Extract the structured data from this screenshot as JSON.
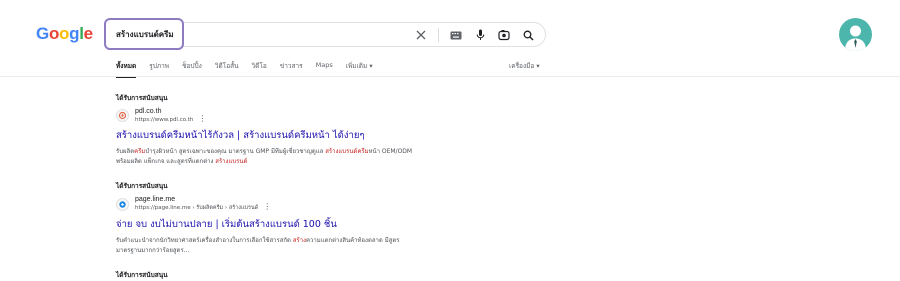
{
  "logo": {
    "letters": [
      "G",
      "o",
      "o",
      "g",
      "l",
      "e"
    ],
    "colors": [
      "#4285f4",
      "#ea4335",
      "#fbbc05",
      "#4285f4",
      "#34a853",
      "#ea4335"
    ]
  },
  "search": {
    "query": "สร้างแบรนด์ครีม"
  },
  "icons": {
    "clear": "close-icon",
    "keyboard": "keyboard-icon",
    "voice": "microphone-icon",
    "lens": "lens-icon",
    "search": "search-icon"
  },
  "tabs": {
    "items": [
      {
        "label": "ทั้งหมด",
        "active": true
      },
      {
        "label": "รูปภาพ",
        "active": false
      },
      {
        "label": "ช็อปปิ้ง",
        "active": false
      },
      {
        "label": "วิดีโอสั้น",
        "active": false
      },
      {
        "label": "วิดีโอ",
        "active": false
      },
      {
        "label": "ข่าวสาร",
        "active": false
      },
      {
        "label": "Maps",
        "active": false
      },
      {
        "label": "เพิ่มเติม",
        "active": false
      }
    ],
    "tools": "เครื่องมือ"
  },
  "results": [
    {
      "sponsored": "ได้รับการสนับสนุน",
      "site": "pdl.co.th",
      "url": "https://www.pdl.co.th",
      "title": "สร้างแบรนด์ครีมหน้าไร้กังวล | สร้างแบรนด์ครีมหน้า ได้ง่ายๆ",
      "desc1_pre": "รับผลิต",
      "desc1_hl1": "ครีม",
      "desc1_mid": "บำรุงผิวหน้า สูตรเฉพาะของคุณ มาตรฐาน GMP มีทีมผู้เชี่ยวชาญดูแล ",
      "desc1_hl2": "สร้างแบรนด์ครีม",
      "desc1_post": "หน้า OEM/ODM",
      "desc2_pre": "พร้อมผลิต แพ็กเกจ และสูตรที่แตกต่าง ",
      "desc2_hl": "สร้างแบรนด์"
    },
    {
      "sponsored": "ได้รับการสนับสนุน",
      "site": "page.line.me",
      "url": "https://page.line.me › รับผลิตครีม › สร้างแบรนด์",
      "title": "จ่าย จบ งบไม่บานปลาย | เริ่มต้นสร้างแบรนด์ 100 ชิ้น",
      "desc1_pre": "รับคำแนะนำจากนักวิทยาศาสตร์เครื่องสำอางในการเลือกใช้สารสกัด ",
      "desc1_hl": "สร้าง",
      "desc1_post": "ความแตกต่างสินค้าท้องตลาด มีสูตร",
      "desc2": "มาตรฐานมากกว่าร้อยสูตร..."
    },
    {
      "sponsored": "ได้รับการสนับสนุน"
    }
  ]
}
